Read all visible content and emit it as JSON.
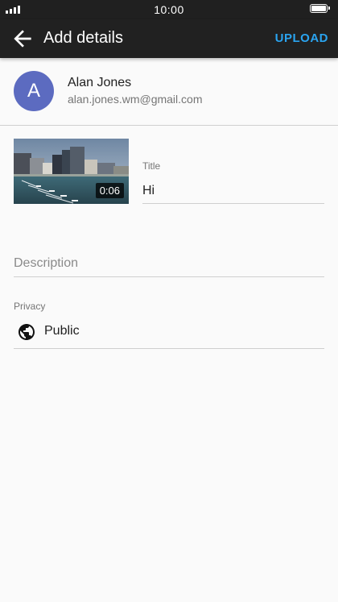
{
  "status_bar": {
    "time": "10:00",
    "battery_level": 1.0
  },
  "app_bar": {
    "title": "Add details",
    "upload_label": "UPLOAD",
    "back_icon": "arrow-back-icon"
  },
  "account": {
    "avatar_letter": "A",
    "name": "Alan Jones",
    "email": "alan.jones.wm@gmail.com"
  },
  "video": {
    "duration": "0:06",
    "title_label": "Title",
    "title_value": "Hi"
  },
  "description": {
    "placeholder": "Description",
    "value": ""
  },
  "privacy": {
    "label": "Privacy",
    "value": "Public",
    "icon": "globe-icon"
  },
  "colors": {
    "app_bar": "#212121",
    "accent": "#2aa4f0",
    "avatar": "#5c6bc0",
    "background": "#fafafa"
  }
}
